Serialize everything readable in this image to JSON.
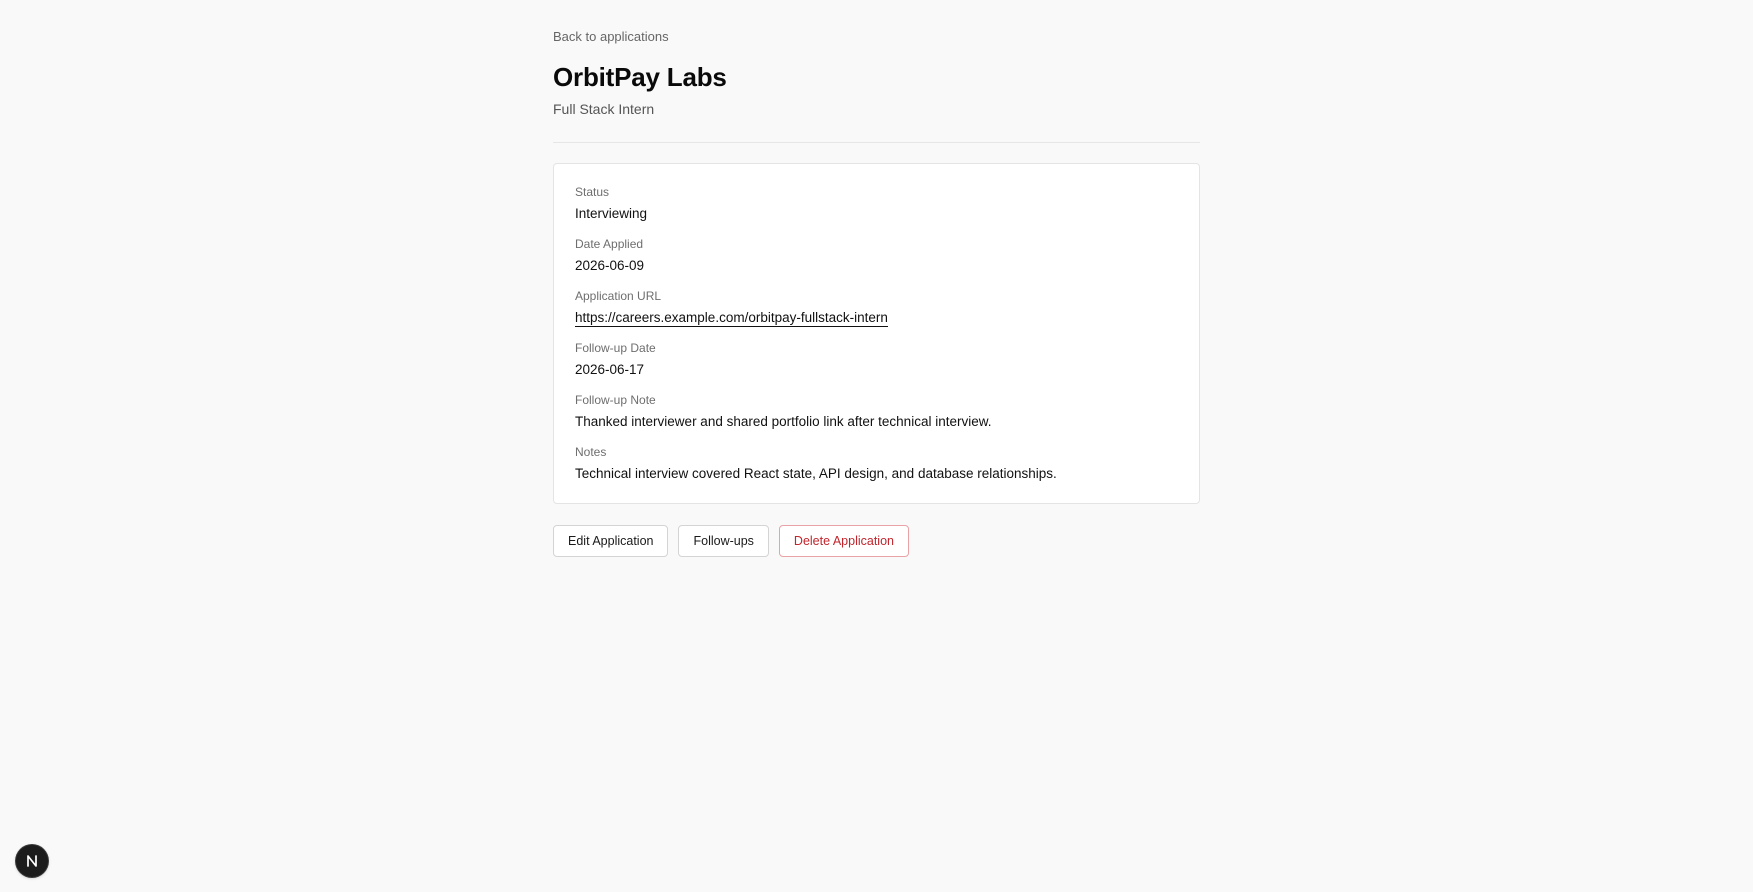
{
  "nav": {
    "back_label": "Back to applications"
  },
  "header": {
    "company": "OrbitPay Labs",
    "role": "Full Stack Intern"
  },
  "details": [
    {
      "label": "Status",
      "value": "Interviewing"
    },
    {
      "label": "Date Applied",
      "value": "2026-06-09"
    },
    {
      "label": "Application URL",
      "value": "https://careers.example.com/orbitpay-fullstack-intern"
    },
    {
      "label": "Follow-up Date",
      "value": "2026-06-17"
    },
    {
      "label": "Follow-up Note",
      "value": "Thanked interviewer and shared portfolio link after technical interview."
    },
    {
      "label": "Notes",
      "value": "Technical interview covered React state, API design, and database relationships."
    }
  ],
  "actions": {
    "edit_label": "Edit Application",
    "followups_label": "Follow-ups",
    "delete_label": "Delete Application"
  },
  "dev_badge": {
    "letter": "N",
    "icon": "nextjs-icon"
  },
  "colors": {
    "background": "#f9f9f9",
    "card": "#ffffff",
    "danger": "#c0262d"
  }
}
